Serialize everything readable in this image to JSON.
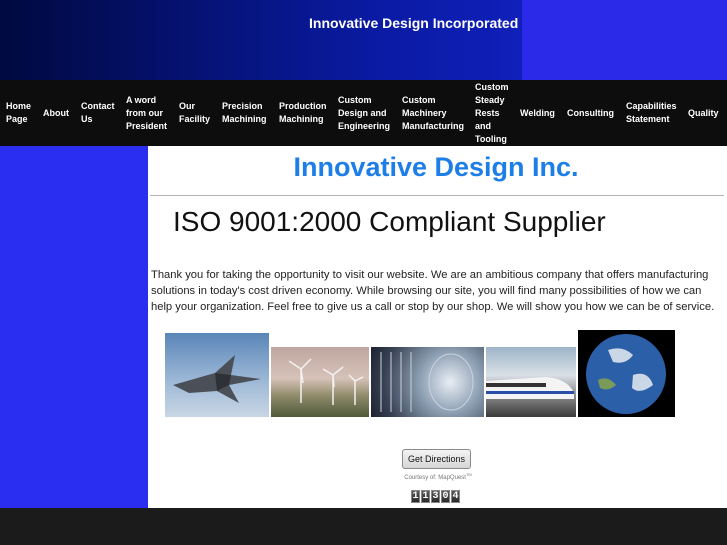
{
  "header": {
    "site_title": "Innovative Design Incorporated"
  },
  "nav": {
    "items": [
      {
        "label": "Home Page"
      },
      {
        "label": "About"
      },
      {
        "label": "Contact Us"
      },
      {
        "label": "A word from our President"
      },
      {
        "label": "Our Facility"
      },
      {
        "label": "Precision Machining"
      },
      {
        "label": "Production Machining"
      },
      {
        "label": "Custom Design and Engineering"
      },
      {
        "label": "Custom Machinery Manufacturing"
      },
      {
        "label": "Custom Steady Rests and Tooling"
      },
      {
        "label": "Welding"
      },
      {
        "label": "Consulting"
      },
      {
        "label": "Capabilities Statement"
      },
      {
        "label": "Quality"
      }
    ]
  },
  "main": {
    "title": "Innovative Design Inc.",
    "subtitle": "ISO 9001:2000 Compliant Supplier",
    "intro": "Thank you for taking the opportunity to visit our website. We are an ambitious company that offers manufacturing solutions in today's cost driven economy. While browsing our site, you will find many possibilities of how we can help your organization. Feel free to give us a call or stop by our shop. We will show you how we can be of service.",
    "get_directions_label": "Get Directions",
    "courtesy_text": "Courtesy of: MapQuest",
    "counter_digits": [
      "1",
      "1",
      "3",
      "0",
      "4"
    ]
  },
  "colors": {
    "title_blue": "#1e7ee8",
    "sidebar_blue": "#2a2ef0",
    "nav_bg": "#0d0d0d"
  }
}
